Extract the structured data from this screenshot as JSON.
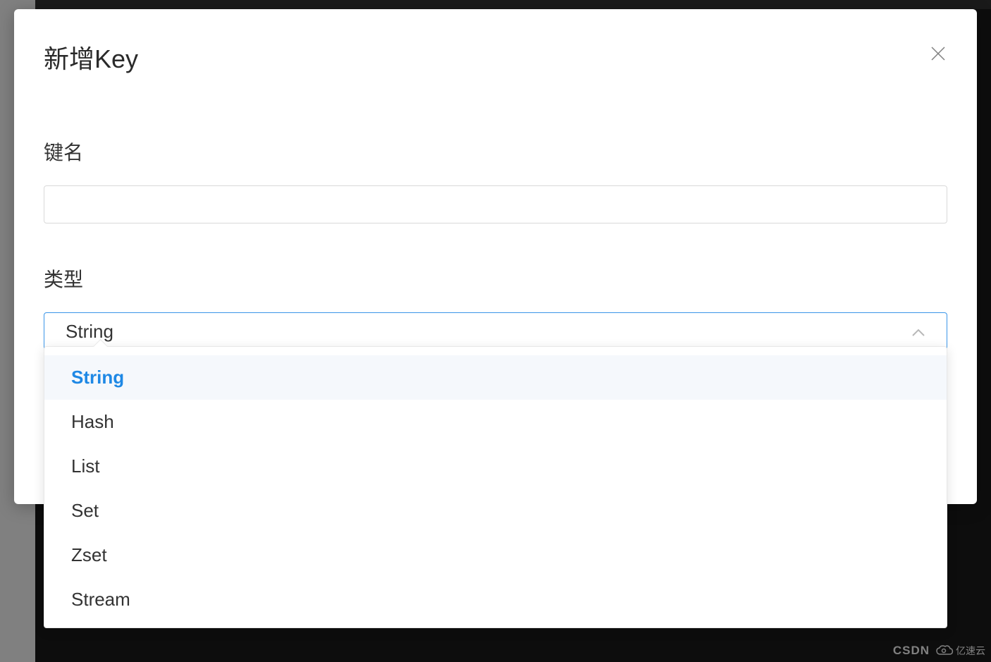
{
  "modal": {
    "title": "新增Key",
    "fields": {
      "keyName": {
        "label": "键名",
        "value": ""
      },
      "type": {
        "label": "类型",
        "selected": "String",
        "options": [
          "String",
          "Hash",
          "List",
          "Set",
          "Zset",
          "Stream"
        ]
      }
    }
  },
  "watermark": {
    "text1": "CSDN",
    "text2": "亿速云"
  }
}
